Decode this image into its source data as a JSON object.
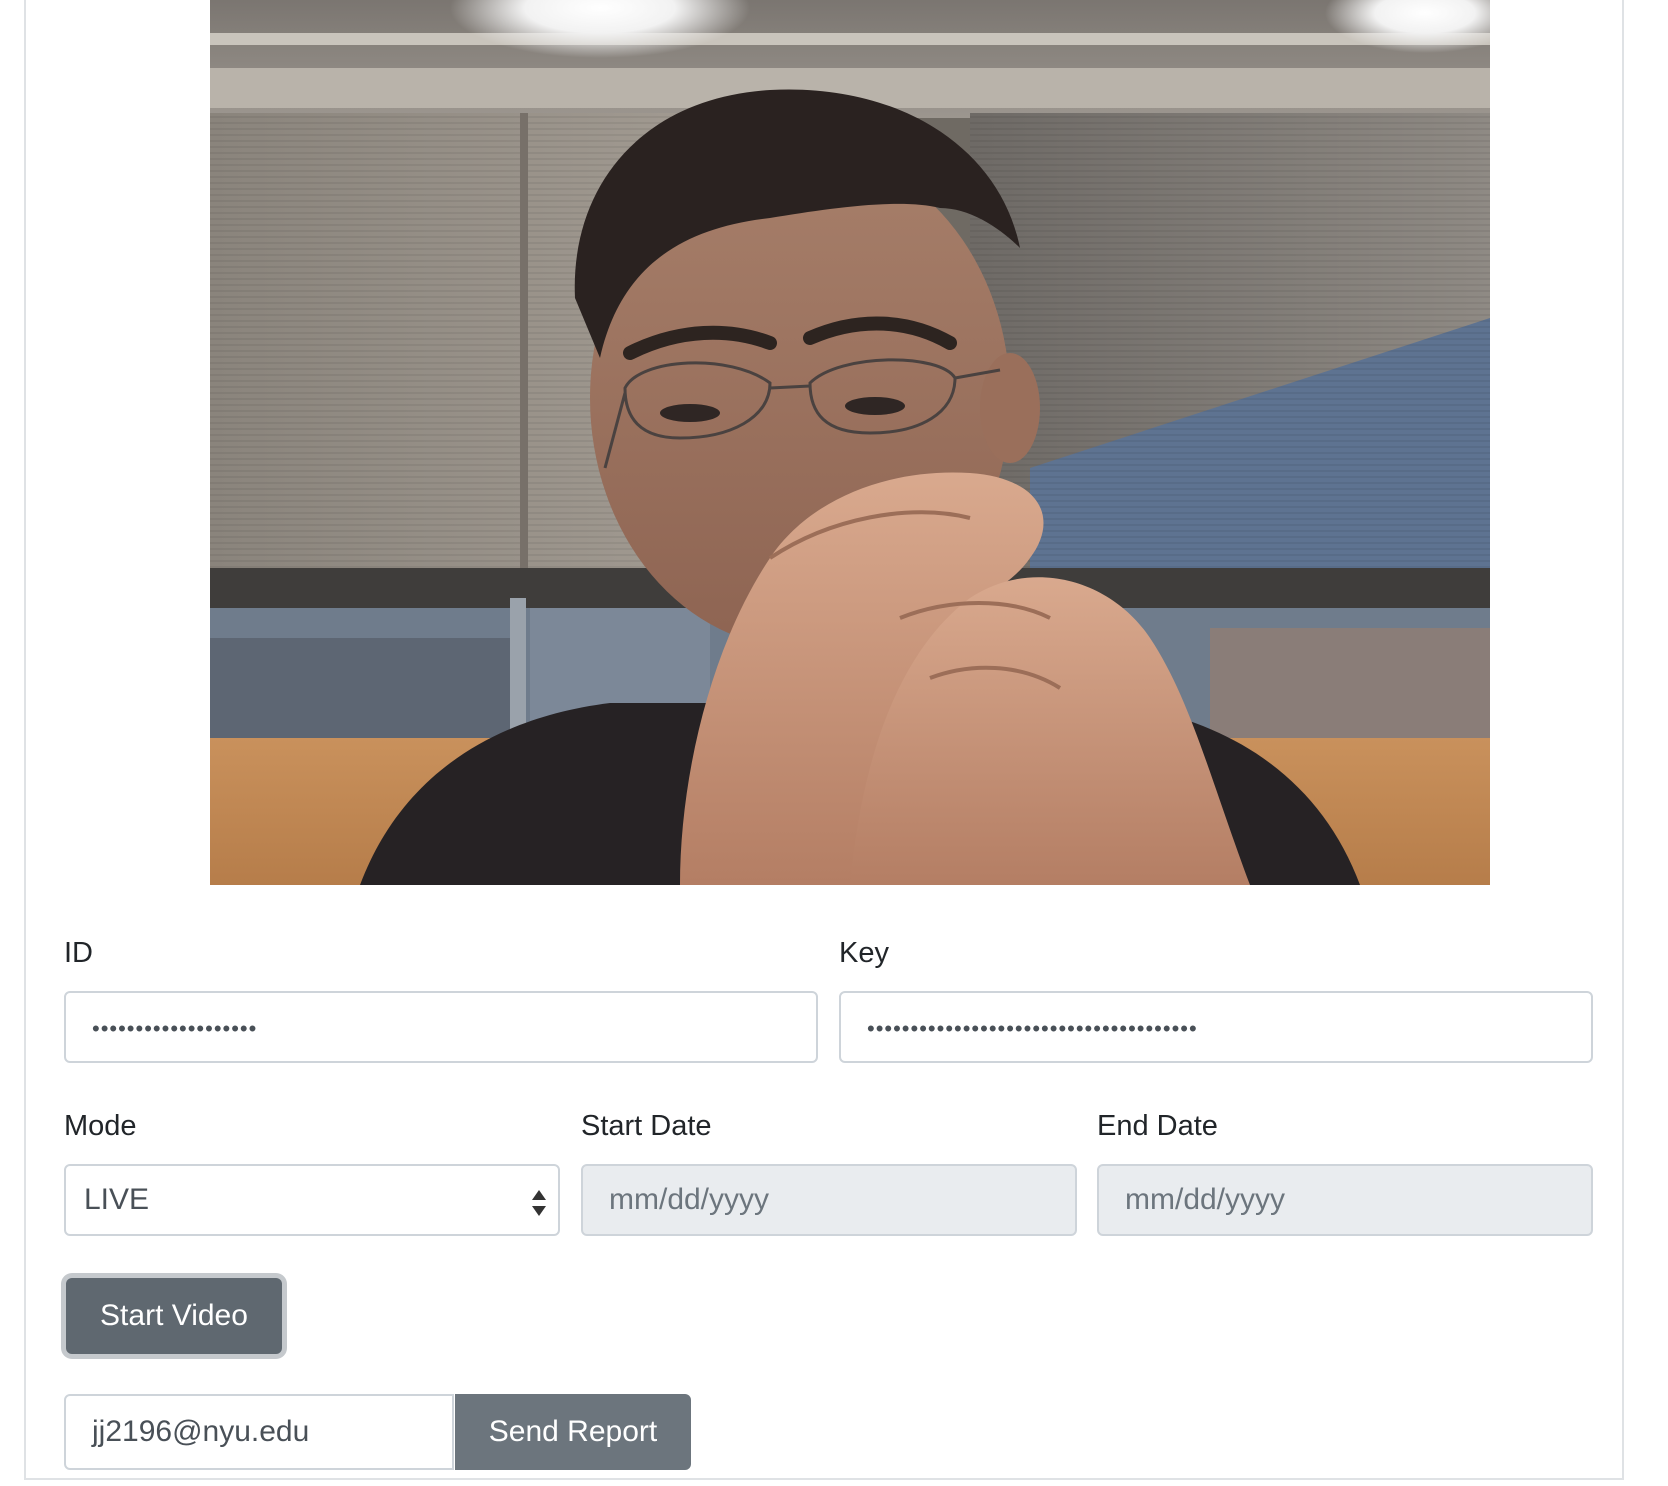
{
  "video": {
    "description_icon": "webcam-feed"
  },
  "form": {
    "id": {
      "label": "ID",
      "value": "•••••••••••••••••••"
    },
    "key": {
      "label": "Key",
      "value": "••••••••••••••••••••••••••••••••••••••"
    },
    "mode": {
      "label": "Mode",
      "value": "LIVE"
    },
    "start_date": {
      "label": "Start Date",
      "placeholder": "mm/dd/yyyy"
    },
    "end_date": {
      "label": "End Date",
      "placeholder": "mm/dd/yyyy"
    }
  },
  "actions": {
    "start_video_label": "Start Video",
    "email_value": "jj2196@nyu.edu",
    "send_report_label": "Send Report"
  },
  "colors": {
    "button_gray": "#6c757d",
    "input_border": "#ced4da",
    "disabled_bg": "#e9ecef"
  }
}
